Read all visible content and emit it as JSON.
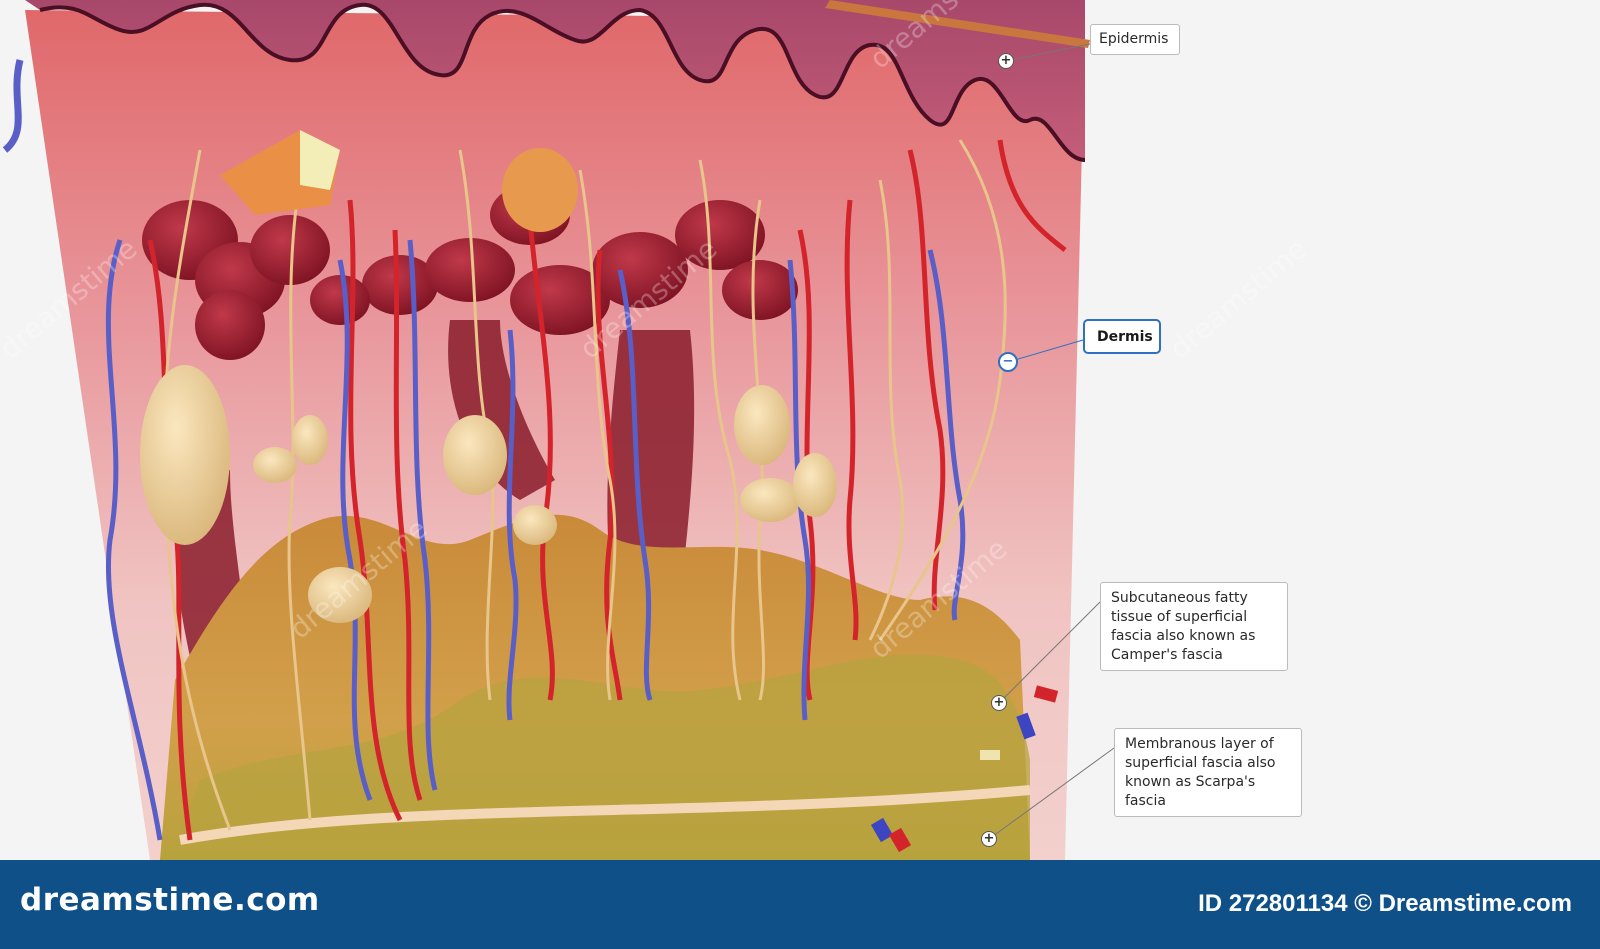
{
  "labels": {
    "epidermis": "Epidermis",
    "dermis": "Dermis",
    "campers": [
      "Subcutaneous fatty",
      "tissue of superficial",
      "fascia also known as",
      "Camper's fascia"
    ],
    "scarpas": [
      "Membranous layer of",
      "superficial fascia also",
      "known as Scarpa's",
      "fascia"
    ]
  },
  "markers": {
    "epidermis": "+",
    "dermis": "−",
    "campers": "+",
    "scarpas": "+"
  },
  "footer": {
    "brand": "dreamstime.com",
    "stock_id": "ID 272801134 © Dreamstime.com"
  },
  "watermark": "dreamstime",
  "colors": {
    "footer_bg": "#0f5089",
    "active_label_border": "#2f6fc4",
    "artery": "#d3242c",
    "vein": "#5a5fc7",
    "nerve": "#e8c58a",
    "fat": "#c98a3a"
  }
}
